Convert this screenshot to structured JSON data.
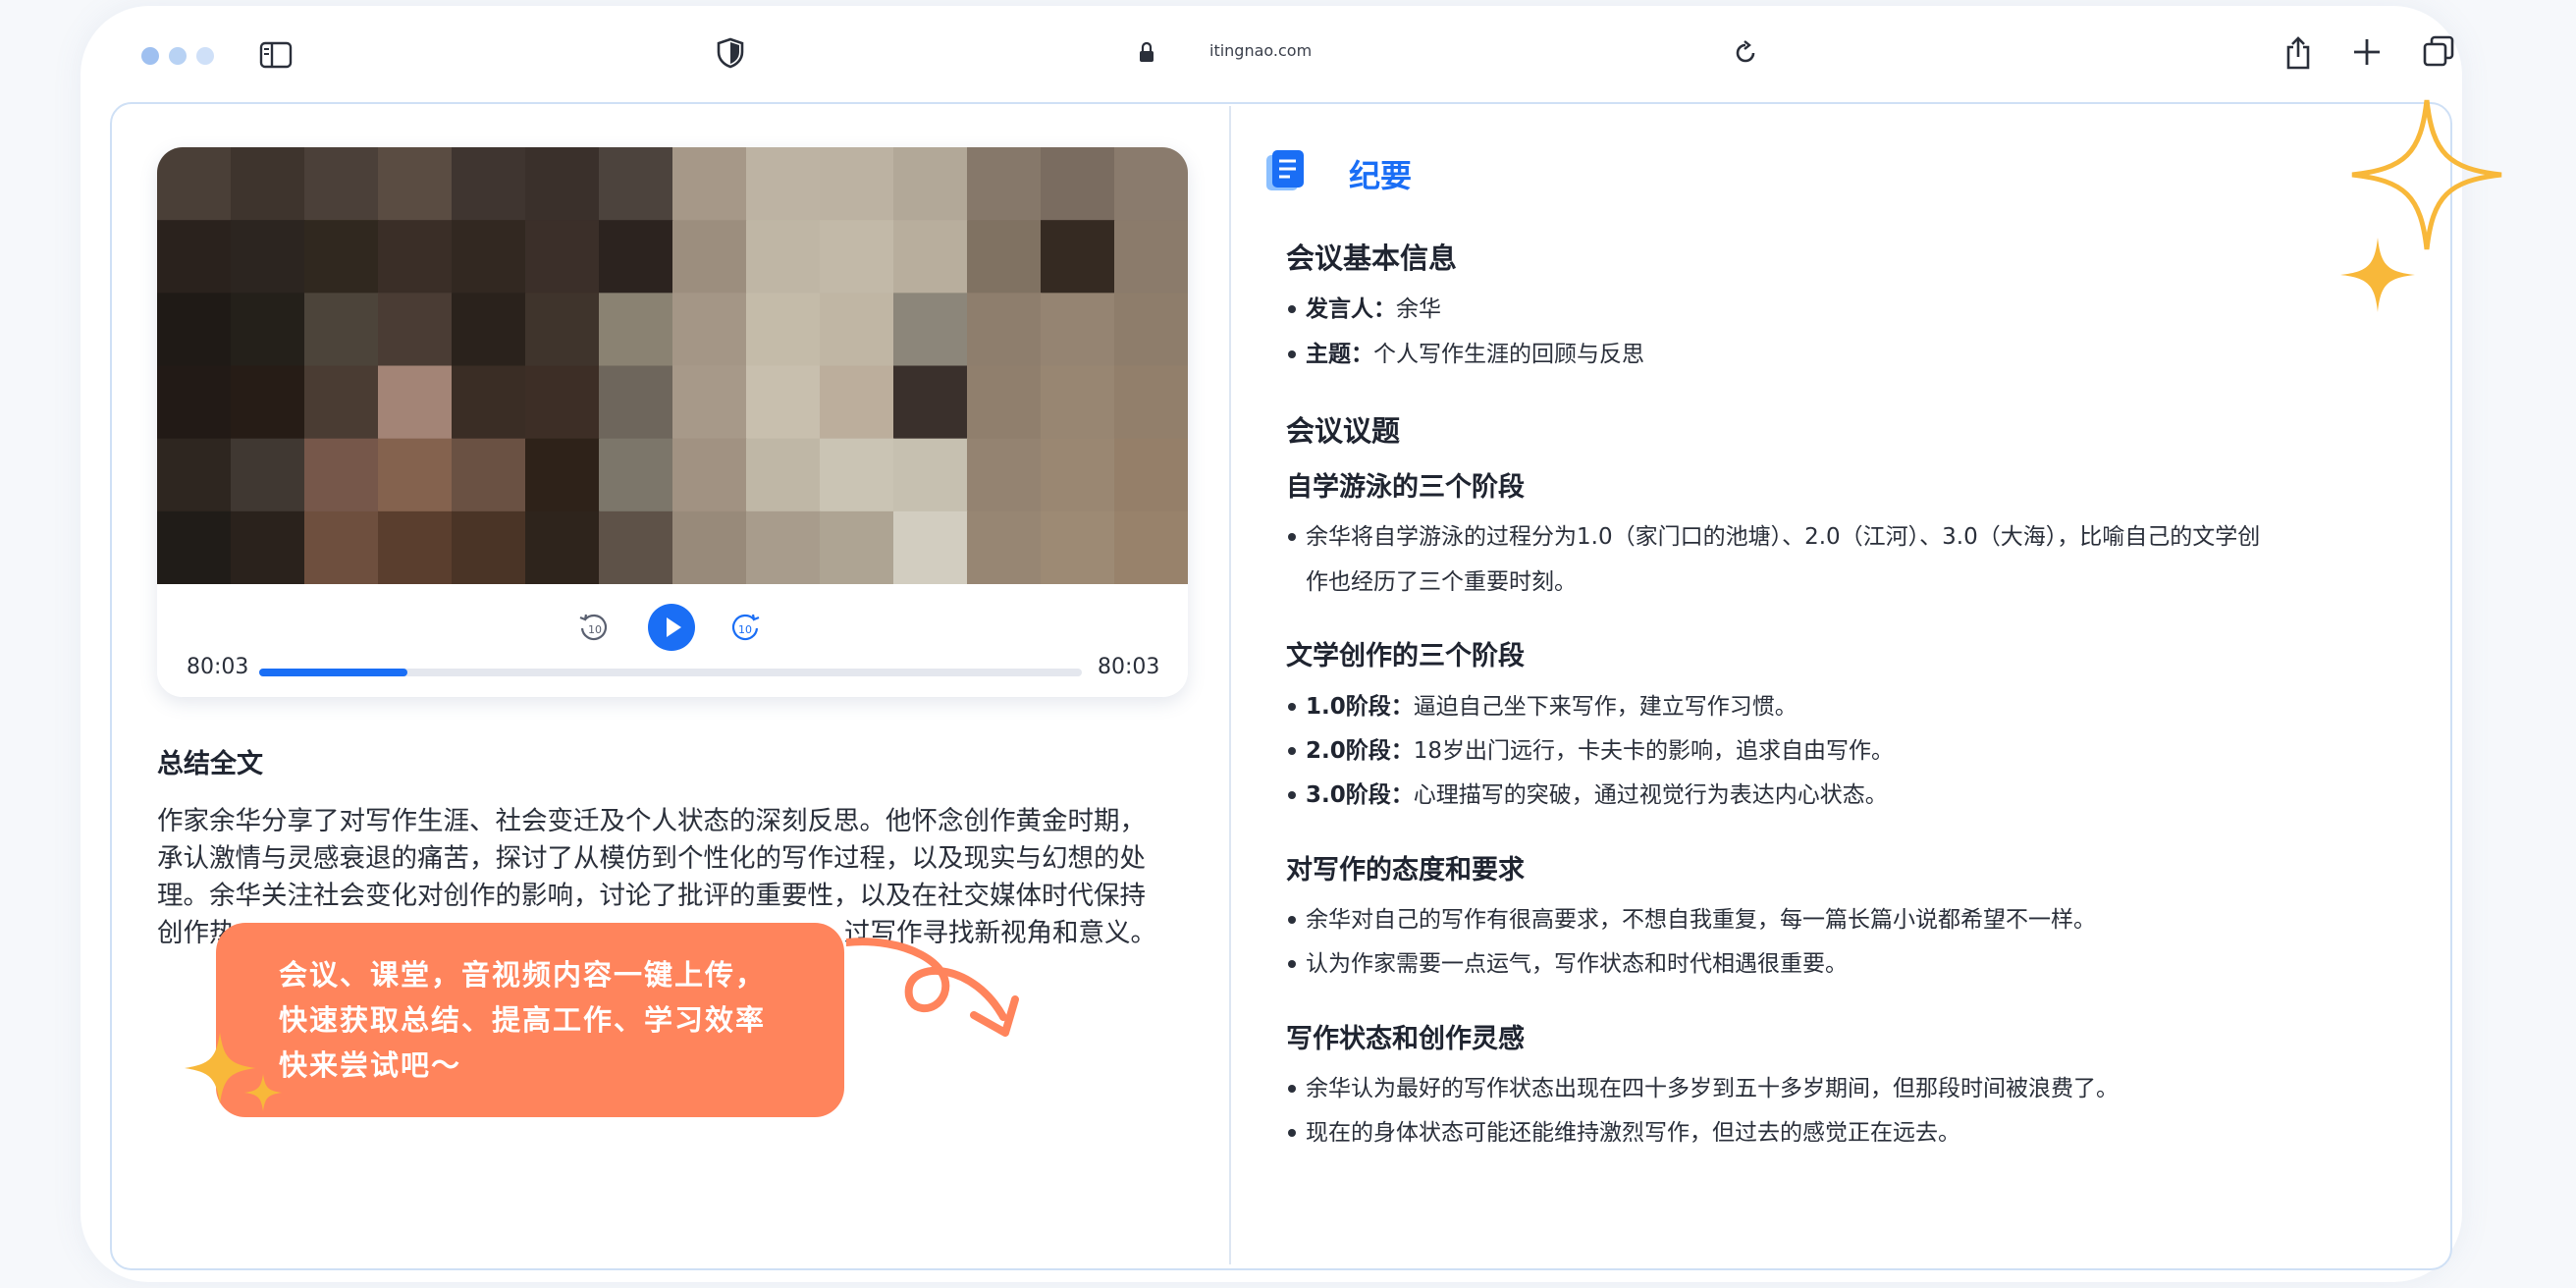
{
  "browser": {
    "url": "itingnao.com",
    "traffic_light_color": "#a9c8f2"
  },
  "player": {
    "time_current": "80:03",
    "time_total": "80:03",
    "progress": 0.18,
    "accent": "#1a6ef5"
  },
  "summary": {
    "title": "总结全文",
    "lines": [
      "作家余华分享了对写作生涯、社会变迁及个人状态的深刻反思。他怀念创作黄金时期，",
      "承认激情与灵感衰退的痛苦，探讨了从模仿到个性化的写作过程，以及现实与幻想的处",
      "理。余华关注社会变化对创作的影响，讨论了批评的重要性，以及在社交媒体时代保持",
      "创作热",
      "过写作寻找新视角和意义。"
    ]
  },
  "promo": {
    "lines": [
      "会议、课堂，音视频内容一键上传，",
      "快速获取总结、提高工作、学习效率",
      "快来尝试吧～"
    ],
    "color": "#ff845c",
    "star_color": "#f8b83a"
  },
  "minutes": {
    "title": "纪要",
    "basic_info": {
      "heading": "会议基本信息",
      "items": [
        {
          "label": "发言人：",
          "text": "余华"
        },
        {
          "label": "主题：",
          "text": "个人写作生涯的回顾与反思"
        }
      ]
    },
    "topics_heading": "会议议题",
    "sections": [
      {
        "heading": "自学游泳的三个阶段",
        "items": [
          {
            "label": "",
            "text": "余华将自学游泳的过程分为1.0（家门口的池塘）、2.0（江河）、3.0（大海），比喻自己的文学创",
            "cont": "作也经历了三个重要时刻。"
          }
        ]
      },
      {
        "heading": "文学创作的三个阶段",
        "items": [
          {
            "label": "1.0阶段：",
            "text": "逼迫自己坐下来写作，建立写作习惯。"
          },
          {
            "label": "2.0阶段：",
            "text": "18岁出门远行，卡夫卡的影响，追求自由写作。"
          },
          {
            "label": "3.0阶段：",
            "text": "心理描写的突破，通过视觉行为表达内心状态。"
          }
        ]
      },
      {
        "heading": "对写作的态度和要求",
        "items": [
          {
            "label": "",
            "text": "余华对自己的写作有很高要求，不想自我重复，每一篇长篇小说都希望不一样。"
          },
          {
            "label": "",
            "text": "认为作家需要一点运气，写作状态和时代相遇很重要。"
          }
        ]
      },
      {
        "heading": "写作状态和创作灵感",
        "items": [
          {
            "label": "",
            "text": "余华认为最好的写作状态出现在四十多岁到五十多岁期间，但那段时间被浪费了。"
          },
          {
            "label": "",
            "text": "现在的身体状态可能还能维持激烈写作，但过去的感觉正在远去。"
          }
        ]
      }
    ]
  }
}
